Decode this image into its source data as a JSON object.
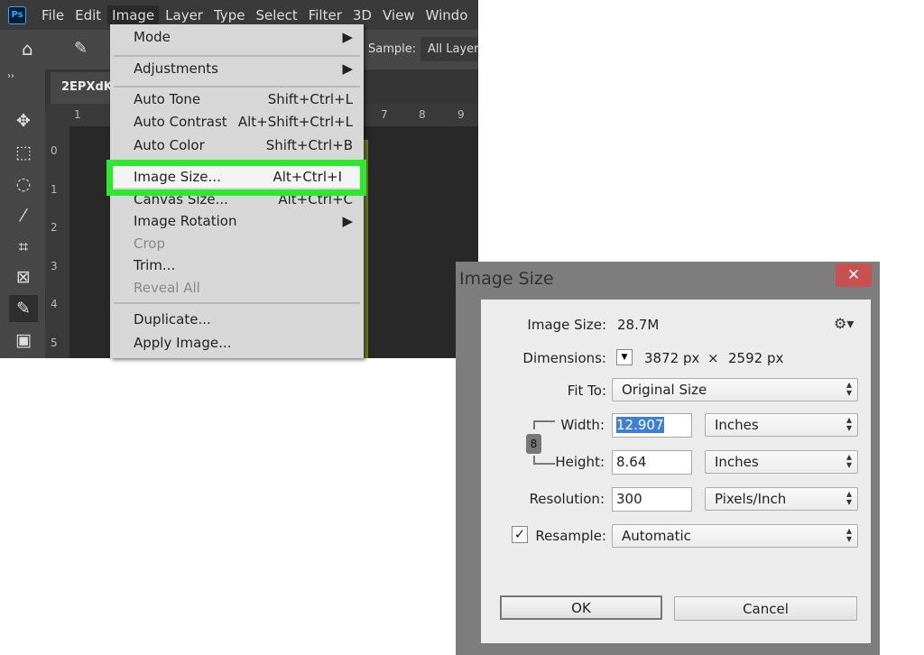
{
  "app": {
    "logo": "Ps",
    "menubar": [
      "File",
      "Edit",
      "Image",
      "Layer",
      "Type",
      "Select",
      "Filter",
      "3D",
      "View",
      "Windo"
    ],
    "active_menu": "Image",
    "options": {
      "sample_label": "Sample:",
      "sample_value": "All Layers"
    },
    "doc_tab": "2EPXdK",
    "ruler_h": [
      "1",
      "7",
      "8",
      "9"
    ],
    "ruler_v": [
      "0",
      "1",
      "2",
      "3",
      "4",
      "5"
    ]
  },
  "image_menu": {
    "items": [
      {
        "label": "Mode",
        "shortcut": "",
        "submenu": true
      },
      {
        "label": "Adjustments",
        "shortcut": "",
        "submenu": true
      },
      {
        "label": "Auto Tone",
        "shortcut": "Shift+Ctrl+L"
      },
      {
        "label": "Auto Contrast",
        "shortcut": "Alt+Shift+Ctrl+L"
      },
      {
        "label": "Auto Color",
        "shortcut": "Shift+Ctrl+B"
      },
      {
        "label": "Image Size...",
        "shortcut": "Alt+Ctrl+I"
      },
      {
        "label": "Canvas Size...",
        "shortcut": "Alt+Ctrl+C"
      },
      {
        "label": "Image Rotation",
        "shortcut": "",
        "submenu": true
      },
      {
        "label": "Crop",
        "shortcut": "",
        "disabled": true
      },
      {
        "label": "Trim...",
        "shortcut": ""
      },
      {
        "label": "Reveal All",
        "shortcut": "",
        "disabled": true
      },
      {
        "label": "Duplicate...",
        "shortcut": ""
      },
      {
        "label": "Apply Image...",
        "shortcut": ""
      }
    ],
    "highlight_color": "#2ee82e"
  },
  "dialog": {
    "title": "Image Size",
    "image_size_label": "Image Size:",
    "image_size_value": "28.7M",
    "dimensions_label": "Dimensions:",
    "dim_width": "3872 px",
    "dim_x": "×",
    "dim_height": "2592 px",
    "fit_to_label": "Fit To:",
    "fit_to_value": "Original Size",
    "width_label": "Width:",
    "width_value": "12.907",
    "width_unit": "Inches",
    "height_label": "Height:",
    "height_value": "8.64",
    "height_unit": "Inches",
    "resolution_label": "Resolution:",
    "resolution_value": "300",
    "resolution_unit": "Pixels/Inch",
    "resample_label": "Resample:",
    "resample_checked": true,
    "resample_value": "Automatic",
    "ok": "OK",
    "cancel": "Cancel"
  }
}
